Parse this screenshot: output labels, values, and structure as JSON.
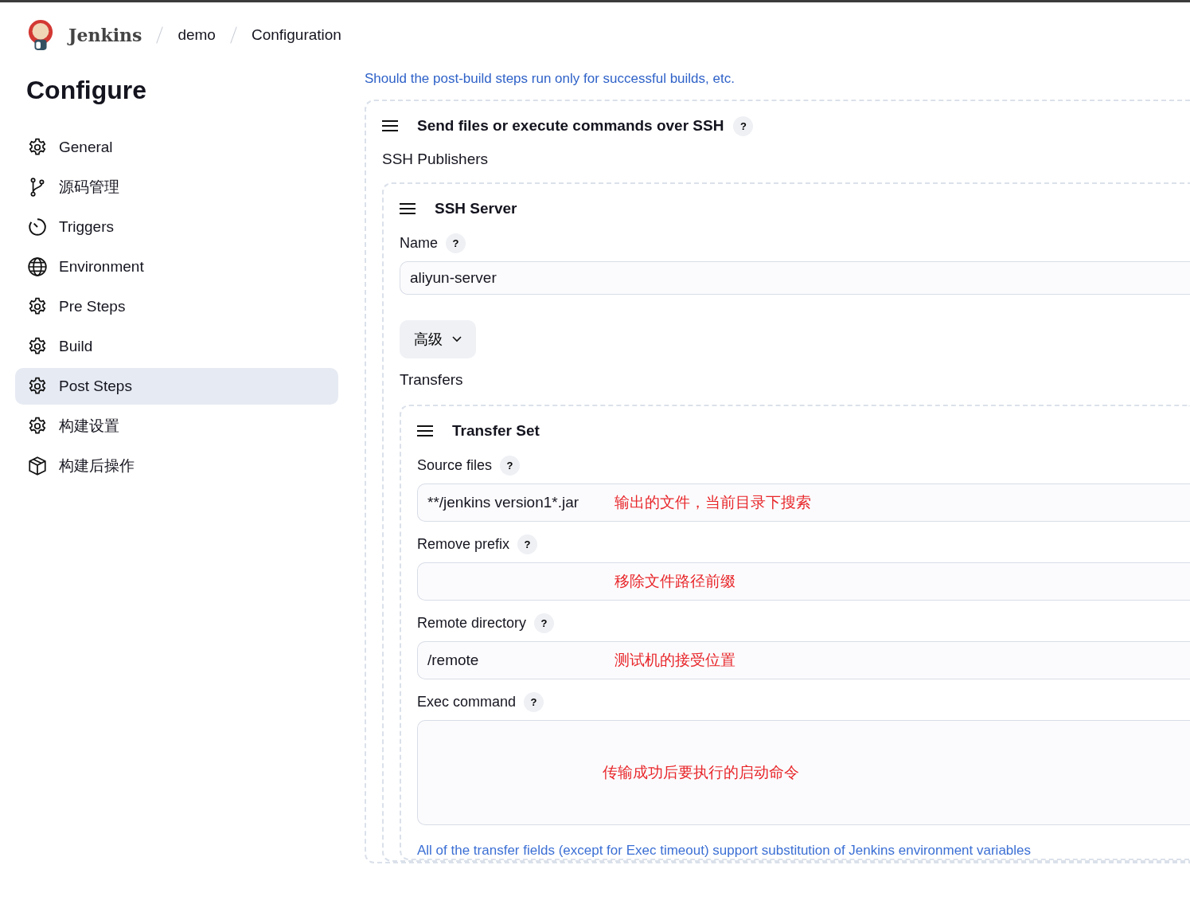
{
  "header": {
    "logo_text": "Jenkins",
    "breadcrumbs": [
      "demo",
      "Configuration"
    ]
  },
  "sidebar": {
    "title": "Configure",
    "items": [
      {
        "label": "General",
        "kind": "gear",
        "selected": false
      },
      {
        "label": "源码管理",
        "kind": "branch",
        "selected": false
      },
      {
        "label": "Triggers",
        "kind": "timer",
        "selected": false
      },
      {
        "label": "Environment",
        "kind": "globe",
        "selected": false
      },
      {
        "label": "Pre Steps",
        "kind": "gear",
        "selected": false
      },
      {
        "label": "Build",
        "kind": "gear",
        "selected": false
      },
      {
        "label": "Post Steps",
        "kind": "gear",
        "selected": true
      },
      {
        "label": "构建设置",
        "kind": "gear",
        "selected": false
      },
      {
        "label": "构建后操作",
        "kind": "package",
        "selected": false
      }
    ]
  },
  "main": {
    "help_link": "Should the post-build steps run only for successful builds, etc.",
    "section": {
      "title": "Send files or execute commands over SSH",
      "help": "?",
      "subtitle": "SSH Publishers",
      "server": {
        "title": "SSH Server",
        "name_label": "Name",
        "name_help": "?",
        "name_value": "aliyun-server",
        "advanced_button": "高级",
        "transfers_label": "Transfers",
        "transfer_set": {
          "title": "Transfer Set",
          "fields": [
            {
              "kind": "input",
              "label": "Source files",
              "help": "?",
              "value": "**/jenkins version1*.jar",
              "annotation": "输出的文件，当前目录下搜索"
            },
            {
              "kind": "input",
              "label": "Remove prefix",
              "help": "?",
              "annotation": "移除文件路径前缀"
            },
            {
              "kind": "input",
              "label": "Remote directory",
              "help": "?",
              "value": "/remote",
              "annotation": "测试机的接受位置"
            },
            {
              "kind": "textarea",
              "label": "Exec command",
              "help": "?",
              "annotation": "传输成功后要执行的启动命令"
            }
          ]
        },
        "footer_note": "All of the transfer fields (except for Exec timeout) support substitution of Jenkins environment variables"
      }
    }
  }
}
